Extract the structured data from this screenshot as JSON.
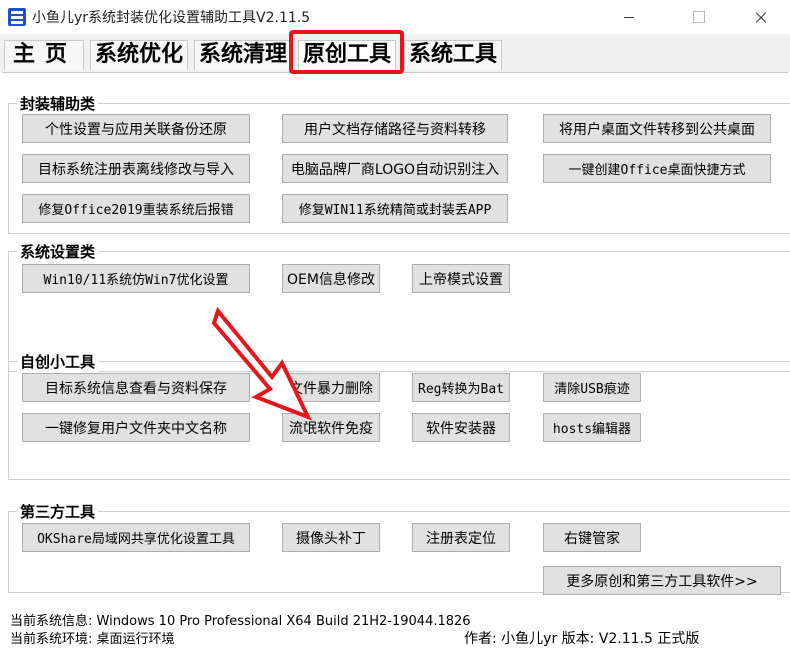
{
  "window": {
    "title": "小鱼儿yr系统封装优化设置辅助工具V2.11.5"
  },
  "tabs": [
    {
      "label": "主页"
    },
    {
      "label": "系统优化"
    },
    {
      "label": "系统清理"
    },
    {
      "label": "原创工具"
    },
    {
      "label": "系统工具"
    }
  ],
  "groups": {
    "packaging": {
      "title": "封装辅助类",
      "buttons": [
        "个性设置与应用关联备份还原",
        "用户文档存储路径与资料转移",
        "将用户桌面文件转移到公共桌面",
        "目标系统注册表离线修改与导入",
        "电脑品牌厂商LOGO自动识别注入",
        "一键创建Office桌面快捷方式",
        "修复Office2019重装系统后报错",
        "修复WIN11系统精简或封装丢APP"
      ]
    },
    "settings": {
      "title": "系统设置类",
      "buttons": [
        "Win10/11系统仿Win7优化设置",
        "OEM信息修改",
        "上帝模式设置"
      ]
    },
    "tools": {
      "title": "自创小工具",
      "buttons": [
        "目标系统信息查看与资料保存",
        "文件暴力删除",
        "Reg转换为Bat",
        "清除USB痕迹",
        "一键修复用户文件夹中文名称",
        "流氓软件免疫",
        "软件安装器",
        "hosts编辑器"
      ]
    },
    "thirdparty": {
      "title": "第三方工具",
      "buttons": [
        "OKShare局域网共享优化设置工具",
        "摄像头补丁",
        "注册表定位",
        "右键管家"
      ],
      "more_label": "更多原创和第三方工具软件>>"
    }
  },
  "status": {
    "system_info": "当前系统信息: Windows 10 Pro Professional X64 Build 21H2-19044.1826",
    "system_env": "当前系统环境: 桌面运行环境",
    "author": "作者: 小鱼儿yr   版本: V2.11.5 正式版"
  },
  "colors": {
    "highlight_red": "#e8141b",
    "button_bg": "#e1e1e1",
    "app_icon_blue": "#1a4fd0"
  }
}
